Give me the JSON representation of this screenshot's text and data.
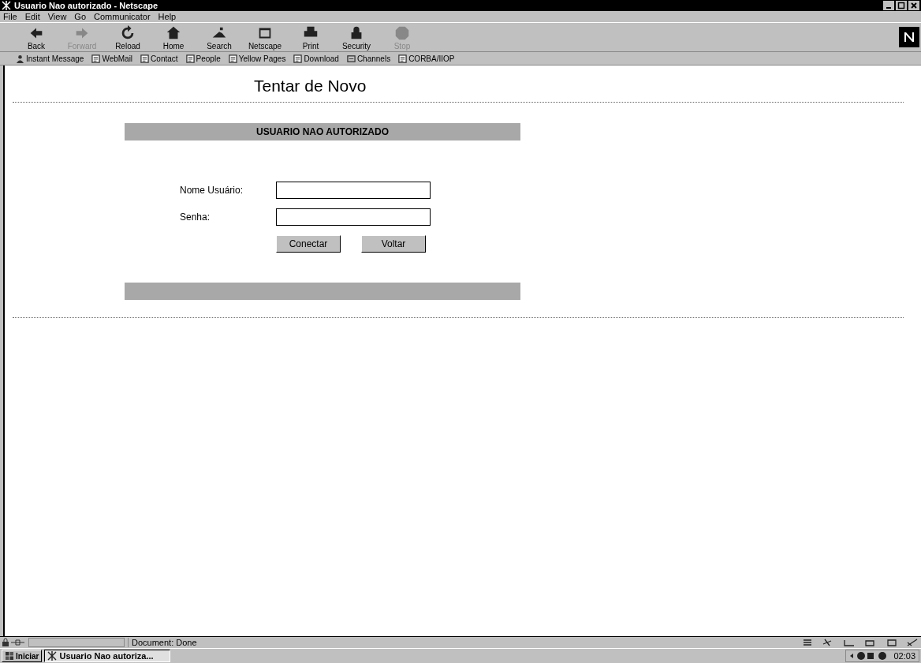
{
  "window": {
    "title": "Usuario Nao autorizado - Netscape"
  },
  "menu": [
    "File",
    "Edit",
    "View",
    "Go",
    "Communicator",
    "Help"
  ],
  "toolbar": [
    {
      "label": "Back",
      "kind": "back",
      "disabled": false
    },
    {
      "label": "Forward",
      "kind": "forward",
      "disabled": true
    },
    {
      "label": "Reload",
      "kind": "reload",
      "disabled": false
    },
    {
      "label": "Home",
      "kind": "home",
      "disabled": false
    },
    {
      "label": "Search",
      "kind": "search",
      "disabled": false
    },
    {
      "label": "Netscape",
      "kind": "netscape",
      "disabled": false
    },
    {
      "label": "Print",
      "kind": "print",
      "disabled": false
    },
    {
      "label": "Security",
      "kind": "security",
      "disabled": false
    },
    {
      "label": "Stop",
      "kind": "stop",
      "disabled": true
    }
  ],
  "personal_toolbar": [
    {
      "label": "Instant Message",
      "kind": "person"
    },
    {
      "label": "WebMail",
      "kind": "bookmark"
    },
    {
      "label": "Contact",
      "kind": "bookmark"
    },
    {
      "label": "People",
      "kind": "bookmark"
    },
    {
      "label": "Yellow Pages",
      "kind": "bookmark"
    },
    {
      "label": "Download",
      "kind": "bookmark"
    },
    {
      "label": "Channels",
      "kind": "channels"
    },
    {
      "label": "CORBA/IIOP",
      "kind": "bookmark"
    }
  ],
  "page": {
    "heading": "Tentar de Novo",
    "banner": "USUARIO NAO AUTORIZADO",
    "fields": [
      {
        "label": "Nome Usuário:"
      },
      {
        "label": "Senha:"
      }
    ],
    "buttons": [
      "Conectar",
      "Voltar"
    ]
  },
  "status_bar": {
    "text": "Document: Done"
  },
  "taskbar": {
    "start": "Iniciar",
    "tasks": [
      {
        "label": "Usuario Nao autoriza...",
        "selected": true
      }
    ],
    "clock": "02:03"
  }
}
